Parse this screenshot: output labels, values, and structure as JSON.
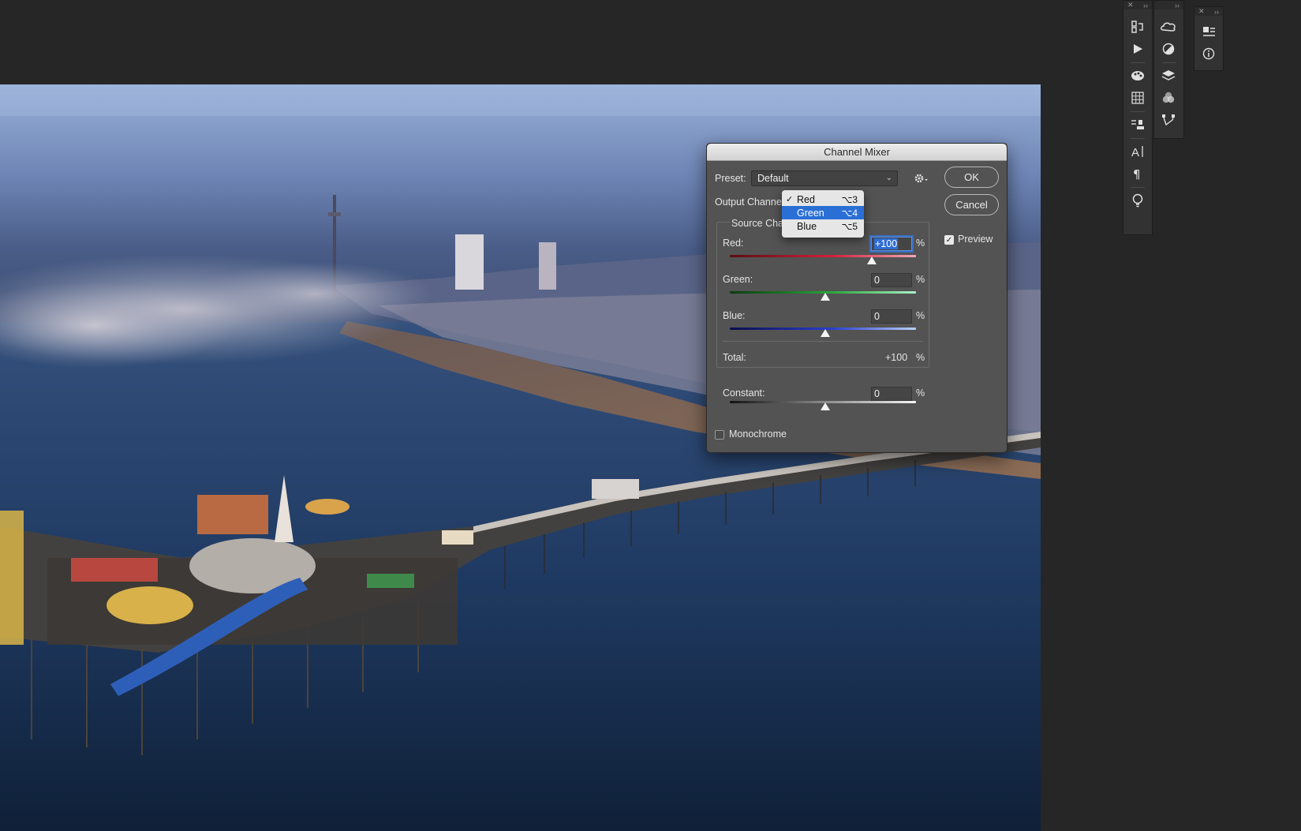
{
  "dialog": {
    "title": "Channel Mixer",
    "preset_label": "Preset:",
    "preset_value": "Default",
    "output_channel_label": "Output Channe",
    "source_channels_label": "Source Cha",
    "ok_label": "OK",
    "cancel_label": "Cancel",
    "preview_label": "Preview",
    "preview_checked": true,
    "monochrome_label": "Monochrome",
    "monochrome_checked": false,
    "percent_symbol": "%",
    "red_label": "Red:",
    "red_value": "+100",
    "green_label": "Green:",
    "green_value": "0",
    "blue_label": "Blue:",
    "blue_value": "0",
    "total_label": "Total:",
    "total_value": "+100",
    "constant_label": "Constant:",
    "constant_value": "0"
  },
  "output_channel_menu": {
    "items": [
      {
        "label": "Red",
        "shortcut": "⌥3",
        "checked": true,
        "highlighted": false
      },
      {
        "label": "Green",
        "shortcut": "⌥4",
        "checked": false,
        "highlighted": true
      },
      {
        "label": "Blue",
        "shortcut": "⌥5",
        "checked": false,
        "highlighted": false
      }
    ]
  },
  "dock": {
    "col1_icons": [
      "history-icon",
      "actions-play-icon",
      "color-palette-icon",
      "swatches-grid-icon",
      "tool-presets-icon",
      "character-icon",
      "paragraph-icon",
      "learn-bulb-icon"
    ],
    "col2_icons": [
      "libraries-icon",
      "adjustments-icon",
      "layers-icon",
      "channels-icon",
      "paths-icon"
    ],
    "col3_icons": [
      "glyphs-icon",
      "info-icon"
    ],
    "collapse_glyph": "››",
    "close_glyph": "✕"
  },
  "colors": {
    "highlight": "#2a6fd6",
    "dialog_bg": "#535353",
    "app_bg": "#262626"
  }
}
